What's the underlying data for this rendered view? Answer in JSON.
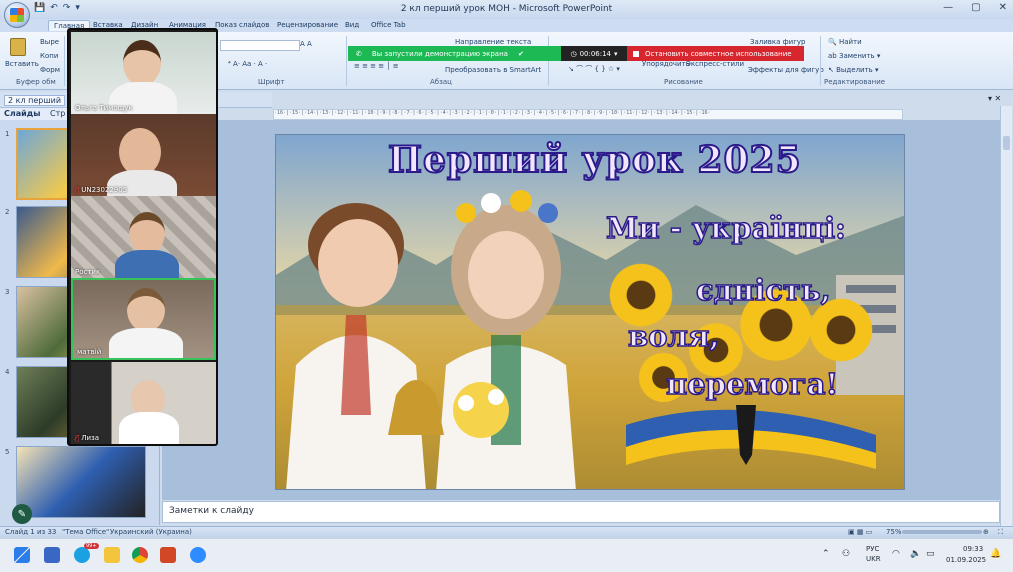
{
  "window": {
    "title": "2 кл перший урок МОН - Microsoft PowerPoint",
    "controls": [
      "—",
      "▢",
      "✕"
    ]
  },
  "ribbon": {
    "tabs": [
      "Главная",
      "Вставка",
      "Дизайн",
      "Анимация",
      "Показ слайдов",
      "Рецензирование",
      "Вид",
      "Office Tab"
    ],
    "active_tab": "Главная",
    "clipboard": {
      "paste_label": "Вставить",
      "cut": "Выре",
      "copy": "Копи",
      "format": "Форм",
      "group": "Буфер обм"
    },
    "font": {
      "group": "Шрифт"
    },
    "paragraph": {
      "direction": "Направление текста",
      "smartart": "Преобразовать в SmartArt",
      "group": "Абзац"
    },
    "drawing": {
      "fill": "Заливка фигур",
      "arrange": "Упорядочить",
      "styles": "Экспресс-стили",
      "effects": "Эффекты для фигур",
      "group": "Рисование"
    },
    "editing": {
      "find": "Найти",
      "replace": "Заменить",
      "select": "Выделить",
      "group": "Редактирование"
    }
  },
  "share_banner": {
    "status": "Вы запустили демонстрацию экрана",
    "timer": "00:06:14",
    "stop": "Остановить совместное использование"
  },
  "document_tab": {
    "name": "2 кл перший"
  },
  "pane_tabs": {
    "slides": "Слайды",
    "outline": "Стр"
  },
  "slide_numbers": [
    "1",
    "2",
    "3",
    "4",
    "5"
  ],
  "participants": [
    {
      "name": "Ольга Тимощук",
      "muted": false
    },
    {
      "name": "UN23022905",
      "muted": true
    },
    {
      "name": "Ростик",
      "muted": false
    },
    {
      "name": "матвій",
      "muted": false,
      "active": true
    },
    {
      "name": "Лиза",
      "muted": true
    }
  ],
  "slide": {
    "title": "Перший урок 2025",
    "line1": "Ми - українці:",
    "line2": "єдність,",
    "line3": "воля,",
    "line4": "перемога!"
  },
  "notes": {
    "placeholder": "Заметки к слайду"
  },
  "statusbar": {
    "slide_count": "Слайд 1 из 33",
    "theme": "\"Тема Office\"",
    "language": "Украинский (Украина)",
    "zoom": "75%"
  },
  "taskbar": {
    "lang_top": "РУС",
    "lang_bottom": "UKR",
    "time": "09:33",
    "date": "01.09.2025",
    "badge": "99+"
  },
  "colors": {
    "share_green": "#1db954",
    "share_red": "#d8262f",
    "active_speaker": "#37c25a",
    "slide_title_fill": "#f2e6ff",
    "slide_title_stroke": "#2a1a8a"
  }
}
